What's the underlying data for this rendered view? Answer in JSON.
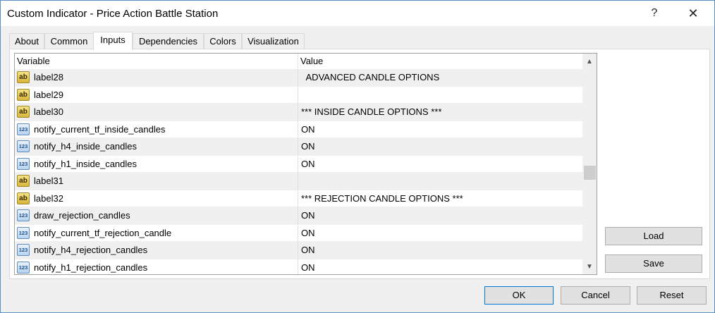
{
  "window": {
    "title": "Custom Indicator - Price Action Battle Station",
    "help_label": "?",
    "close_label": "✕"
  },
  "tabs": [
    {
      "label": "About"
    },
    {
      "label": "Common"
    },
    {
      "label": "Inputs"
    },
    {
      "label": "Dependencies"
    },
    {
      "label": "Colors"
    },
    {
      "label": "Visualization"
    }
  ],
  "active_tab": "Inputs",
  "grid": {
    "headers": {
      "variable": "Variable",
      "value": "Value"
    },
    "rows": [
      {
        "icon": "ab",
        "variable": "label28",
        "value": "  ADVANCED CANDLE OPTIONS"
      },
      {
        "icon": "ab",
        "variable": "label29",
        "value": ""
      },
      {
        "icon": "ab",
        "variable": "label30",
        "value": "*** INSIDE CANDLE OPTIONS ***"
      },
      {
        "icon": "123",
        "variable": "notify_current_tf_inside_candles",
        "value": "ON"
      },
      {
        "icon": "123",
        "variable": "notify_h4_inside_candles",
        "value": "ON"
      },
      {
        "icon": "123",
        "variable": "notify_h1_inside_candles",
        "value": "ON"
      },
      {
        "icon": "ab",
        "variable": "label31",
        "value": ""
      },
      {
        "icon": "ab",
        "variable": "label32",
        "value": "*** REJECTION CANDLE OPTIONS ***"
      },
      {
        "icon": "123",
        "variable": "draw_rejection_candles",
        "value": "ON"
      },
      {
        "icon": "123",
        "variable": "notify_current_tf_rejection_candle",
        "value": "ON"
      },
      {
        "icon": "123",
        "variable": "notify_h4_rejection_candles",
        "value": "ON"
      },
      {
        "icon": "123",
        "variable": "notify_h1_rejection_candles",
        "value": "ON"
      }
    ],
    "icon_text": {
      "ab": "ab",
      "num": "123"
    }
  },
  "side_buttons": {
    "load": "Load",
    "save": "Save"
  },
  "footer_buttons": {
    "ok": "OK",
    "cancel": "Cancel",
    "reset": "Reset"
  },
  "colors": {
    "accent": "#0078d7",
    "window_border": "#5b8fc9",
    "alt_row": "#f0f0f0"
  }
}
